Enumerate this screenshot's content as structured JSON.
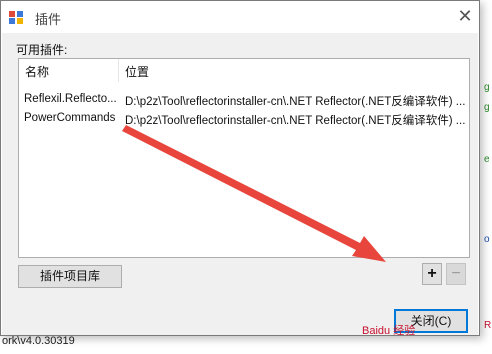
{
  "window": {
    "title": "插件"
  },
  "dialog": {
    "available_label": "可用插件:",
    "columns": [
      "名称",
      "位置"
    ],
    "rows": [
      {
        "name": "Reflexil.Reflecto...",
        "location": "D:\\p2z\\Tool\\reflectorinstaller-cn\\.NET Reflector(.NET反编译软件) ..."
      },
      {
        "name": "PowerCommands",
        "location": "D:\\p2z\\Tool\\reflectorinstaller-cn\\.NET Reflector(.NET反编译软件) ..."
      }
    ],
    "library_button": "插件项目库",
    "add_button": "+",
    "remove_button": "−",
    "close_button": "关闭(C)"
  },
  "background": {
    "bottom_text": "ork\\v4.0.30319"
  },
  "watermark": {
    "text": "Baidu 经验"
  },
  "colors": {
    "arrow": "#e8463d",
    "focus": "#0078d7"
  }
}
